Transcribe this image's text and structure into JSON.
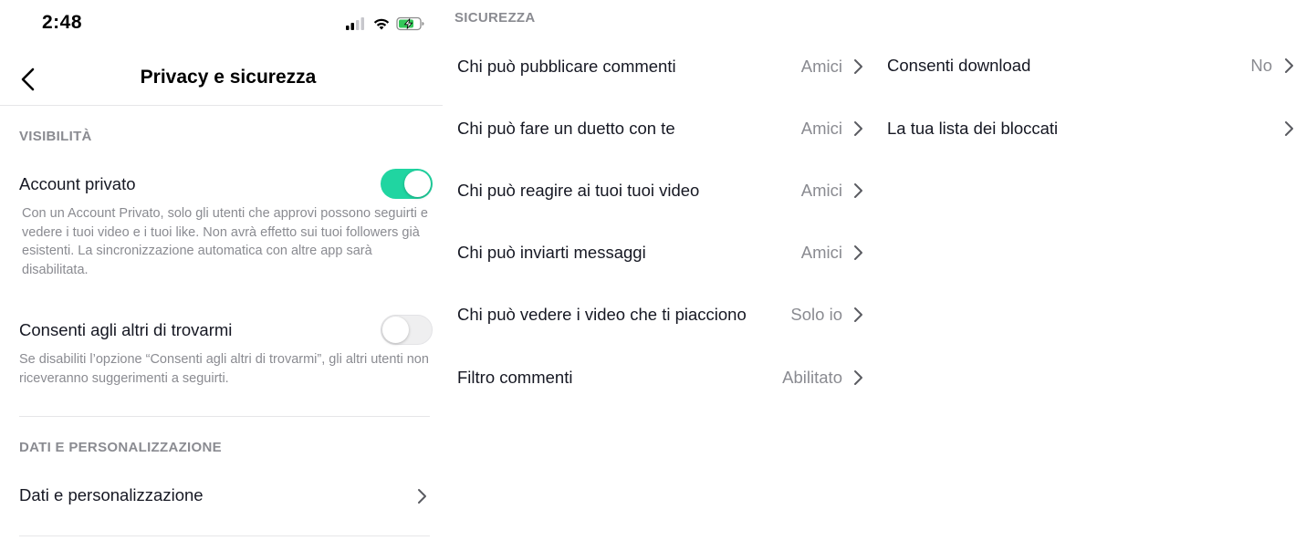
{
  "status_bar": {
    "time": "2:48"
  },
  "header": {
    "title": "Privacy e sicurezza"
  },
  "visibility": {
    "section_title": "VISIBILITÀ",
    "private_account": {
      "label": "Account privato",
      "enabled": true,
      "description": "Con un Account Privato, solo gli utenti che approvi possono seguirti e vedere i tuoi video e i tuoi like. Non avrà effetto sui tuoi followers già esistenti. La sincronizzazione automatica con altre app sarà disabilitata."
    },
    "findable": {
      "label": "Consenti agli altri di trovarmi",
      "enabled": false,
      "description": "Se disabiliti l’opzione “Consenti agli altri di trovarmi”, gli altri utenti non riceveranno suggerimenti a seguirti."
    }
  },
  "data_personalization": {
    "section_title": "DATI E PERSONALIZZAZIONE",
    "item_label": "Dati e personalizzazione"
  },
  "security": {
    "section_title": "SICUREZZA",
    "items": [
      {
        "label": "Chi può pubblicare commenti",
        "value": "Amici"
      },
      {
        "label": "Chi può fare un duetto con te",
        "value": "Amici"
      },
      {
        "label": "Chi può reagire ai tuoi tuoi video",
        "value": "Amici"
      },
      {
        "label": "Chi può inviarti messaggi",
        "value": "Amici"
      },
      {
        "label": "Chi può vedere i video che ti piacciono",
        "value": "Solo io"
      },
      {
        "label": "Filtro commenti",
        "value": "Abilitato"
      }
    ]
  },
  "more": {
    "items": [
      {
        "label": "Consenti download",
        "value": "No"
      },
      {
        "label": "La tua lista dei bloccati",
        "value": ""
      }
    ]
  },
  "colors": {
    "toggle_on": "#20d5a1",
    "text_primary": "#161823",
    "text_secondary": "#8a8b91",
    "battery_charging": "#34c759"
  },
  "icons": [
    "back-arrow-icon",
    "cellular-signal-icon",
    "wifi-icon",
    "battery-charging-icon",
    "chevron-right-icon"
  ]
}
